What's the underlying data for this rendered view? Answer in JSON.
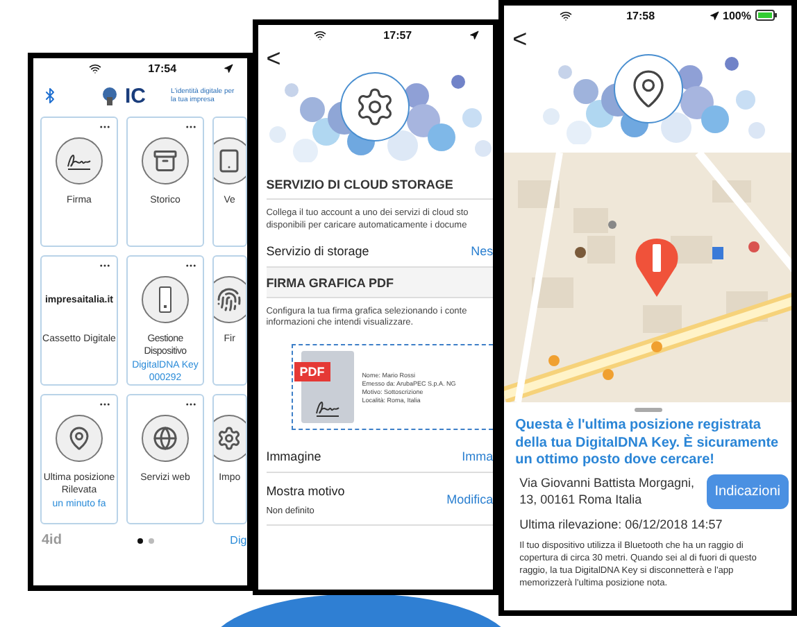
{
  "home_screen": {
    "status_time": "17:54",
    "brand": "IC",
    "tagline": "L'identità digitale per la tua impresa",
    "tiles": [
      {
        "kind": "icon",
        "label": "Firma"
      },
      {
        "kind": "icon",
        "label": "Storico"
      },
      {
        "kind": "icon",
        "label": "Ve"
      },
      {
        "kind": "logo",
        "logo_text": "impresaitalia.it",
        "label": "Cassetto Digitale"
      },
      {
        "kind": "icon",
        "label": "Gestione Dispositivo",
        "sublabel": "DigitalDNA Key 000292"
      },
      {
        "kind": "icon",
        "label": "Fir"
      },
      {
        "kind": "icon",
        "label": "Ultima posizione Rilevata",
        "sublabel": "un minuto fa"
      },
      {
        "kind": "icon",
        "label": "Servizi web"
      },
      {
        "kind": "icon",
        "label": "Impo"
      }
    ],
    "footer_logo": "4id",
    "pager": [
      {
        "selected": true
      },
      {
        "selected": false
      }
    ],
    "footer_link": "Dig"
  },
  "settings_screen": {
    "status_time": "17:57",
    "back": "<",
    "sections": [
      {
        "title": "SERVIZIO DI CLOUD STORAGE",
        "description": [
          "Collega il tuo account a uno dei servizi di cloud sto",
          "disponibili per caricare automaticamente i docume"
        ],
        "rows": [
          {
            "label": "Servizio di storage",
            "value": "Nes"
          }
        ]
      },
      {
        "title": "FIRMA GRAFICA PDF",
        "description": [
          "Configura la tua firma grafica selezionando i conte",
          "informazioni che intendi visualizzare."
        ],
        "preview": {
          "badge": "PDF",
          "lines": [
            "Nome: Mario Rossi",
            "Emesso da: ArubaPEC S.p.A. NG",
            "Motivo: Sottoscrizione",
            "Località: Roma, Italia"
          ]
        },
        "rows": [
          {
            "label": "Immagine",
            "value": "Imma"
          },
          {
            "label": "Mostra motivo",
            "value": "Modifica",
            "sublabel": "Non definito"
          }
        ]
      }
    ]
  },
  "location_screen": {
    "status_time": "17:58",
    "battery": "100%",
    "back": "<",
    "headline": "Questa è l'ultima posizione registrata della tua DigitalDNA Key.  È sicuramente un ottimo posto dove cercare!",
    "address": "Via Giovanni Battista Morgagni, 13, 00161 Roma Italia",
    "button": "Indicazioni",
    "last_seen": "Ultima rilevazione: 06/12/2018 14:57",
    "note": "Il tuo dispositivo utilizza il Bluetooth che ha un raggio di copertura di circa 30 metri. Quando sei al di fuori di questo raggio, la tua DigitalDNA Key si disconnetterà e l'app memorizzerà l'ultima posizione nota."
  }
}
